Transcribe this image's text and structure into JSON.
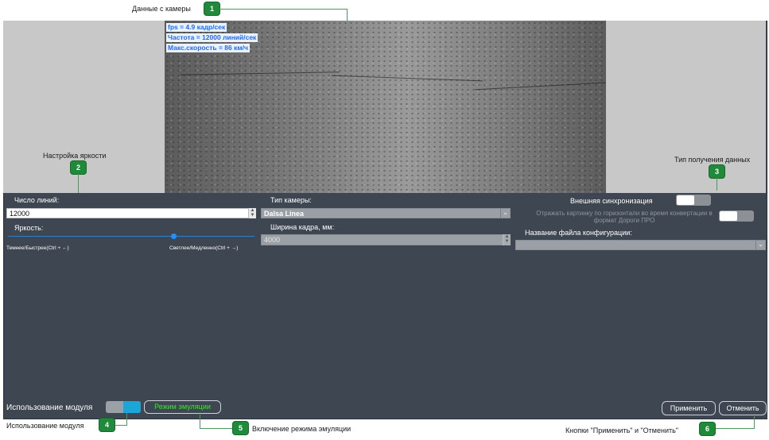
{
  "callouts": {
    "c1": {
      "text": "Данные с камеры",
      "num": "1"
    },
    "c2": {
      "text": "Настройка яркости",
      "num": "2"
    },
    "c3": {
      "text": "Тип получения данных",
      "num": "3"
    },
    "c4": {
      "text": "Использование модуля",
      "num": "4"
    },
    "c5": {
      "text": "Включение режима эмуляции",
      "num": "5"
    },
    "c6": {
      "text": "Кнопки \"Применить\" и \"Отменить\"",
      "num": "6"
    }
  },
  "camera": {
    "stats": [
      "fps = 4.9 кадр/сек",
      "Частота = 12000 линий/сек",
      "Макс.скорость = 86 км/ч"
    ]
  },
  "form": {
    "lines_label": "Число линий:",
    "lines_value": "12000",
    "brightness_label": "Яркость:",
    "brightness_level": 0.67,
    "brightness_left": "Темнее/Быстрее(Ctrl + ←)",
    "brightness_right": "Светлее/Медленно(Ctrl + →)",
    "camera_type_label": "Тип камеры:",
    "camera_type_value": "Dalsa Linea",
    "frame_width_label": "Ширина кадра, мм:",
    "frame_width_value": "4000",
    "ext_sync_label": "Внешняя синхронизация",
    "mirror_label": "Отражать картинку по горизонтали во время конвертации в формат Дороги ПРО",
    "config_label": "Название файла конфигурации:",
    "config_value": ""
  },
  "bottom": {
    "module_label": "Использование модуля",
    "emulation_button": "Режим эмуляции",
    "apply_button": "Применить",
    "cancel_button": "Отменить"
  },
  "colors": {
    "panel": "#3e4651",
    "badge": "#1e8a3a",
    "accent": "#1e90ff",
    "emulation_text": "#39e62e"
  }
}
